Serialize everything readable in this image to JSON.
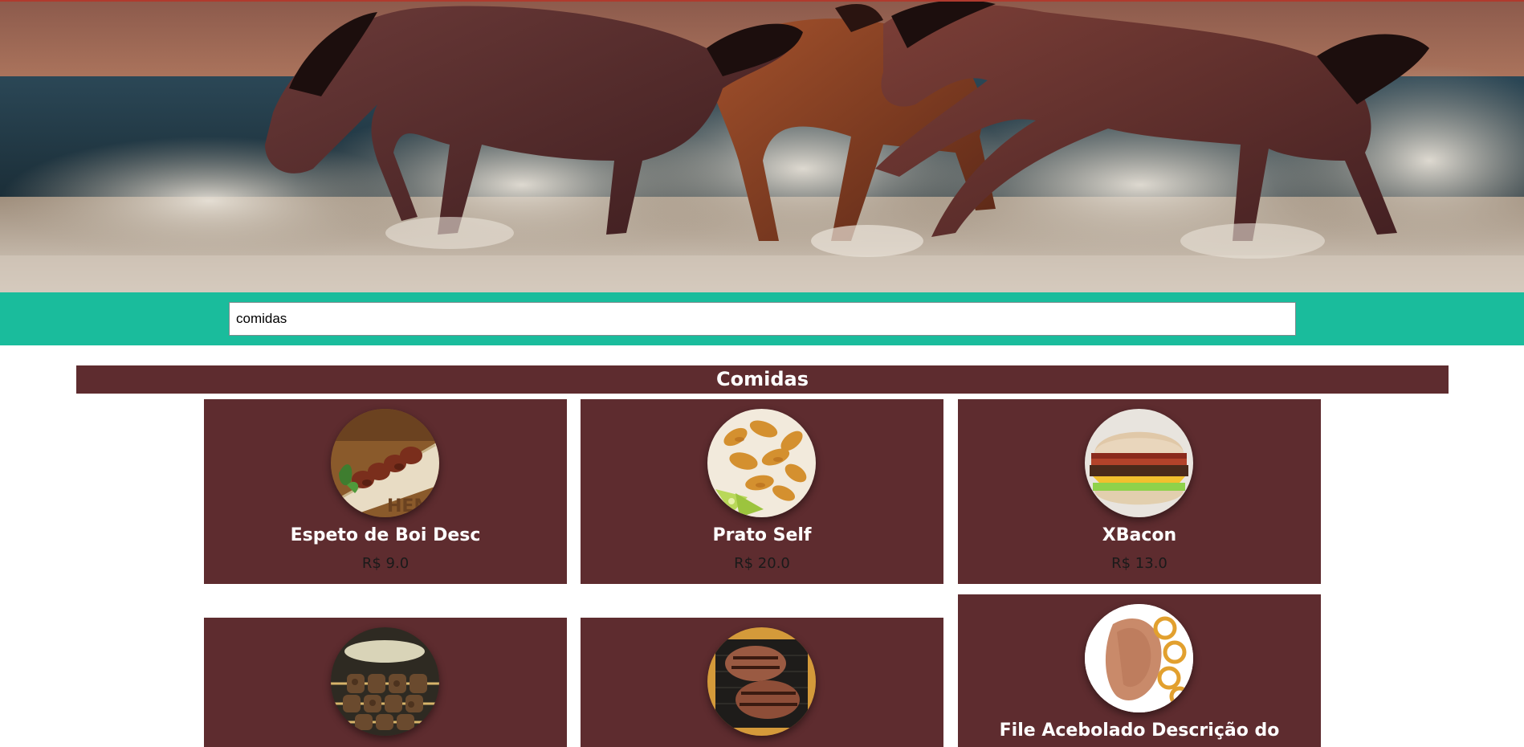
{
  "search": {
    "value": "comidas",
    "placeholder": ""
  },
  "category": {
    "title": "Comidas"
  },
  "products": [
    {
      "name": "Espeto de Boi Desc",
      "price": "R$ 9.0",
      "image": "beef-skewer-photo"
    },
    {
      "name": "Prato Self",
      "price": "R$ 20.0",
      "image": "fried-fish-photo"
    },
    {
      "name": "XBacon",
      "price": "R$ 13.0",
      "image": "bacon-burger-photo"
    },
    {
      "name": "",
      "price": "",
      "image": "skewers-photo"
    },
    {
      "name": "",
      "price": "",
      "image": "steak-photo"
    },
    {
      "name": "File Acebolado Descrição do",
      "price": "",
      "image": "steak-with-onions-photo"
    }
  ],
  "colors": {
    "accent": "#1abc9c",
    "card": "#5e2c2f",
    "hero_top": "#b03a2e"
  },
  "hero": {
    "image": "horses-running-in-surf-photo"
  }
}
